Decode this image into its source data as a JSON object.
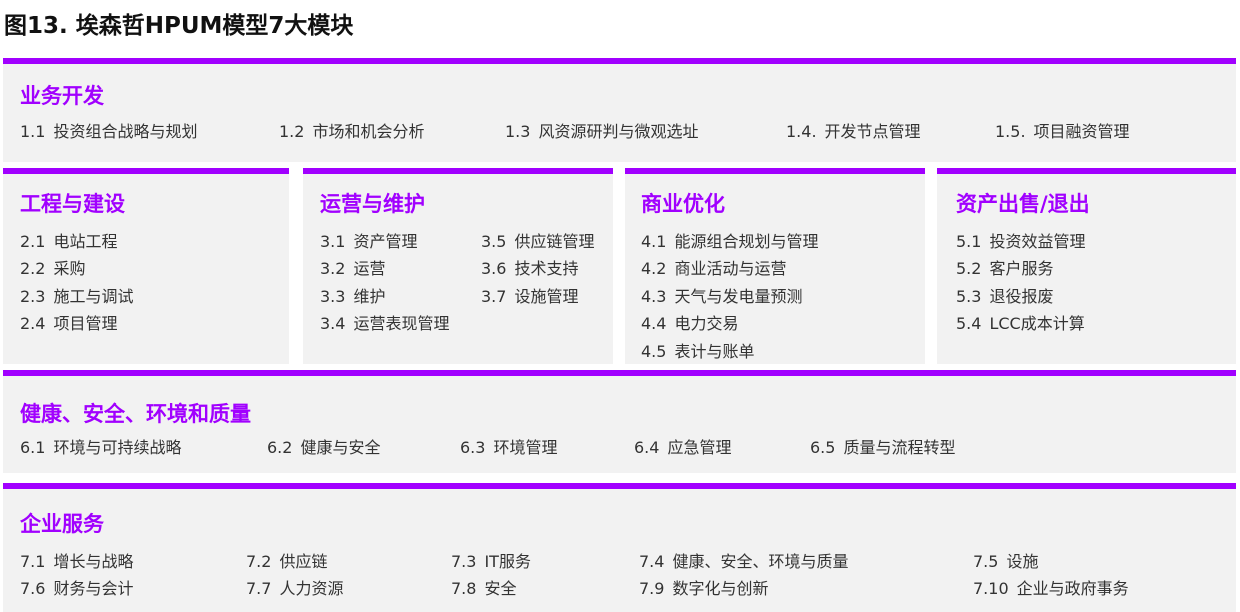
{
  "title": "图13. 埃森哲HPUM模型7大模块",
  "accent_color": "#a100ff",
  "panel_bg": "#f2f2f2",
  "modules": [
    {
      "heading": "业务开发",
      "items": [
        {
          "num": "1.1",
          "text": "投资组合战略与规划"
        },
        {
          "num": "1.2",
          "text": "市场和机会分析"
        },
        {
          "num": "1.3",
          "text": "风资源研判与微观选址"
        },
        {
          "num": "1.4.",
          "text": "开发节点管理"
        },
        {
          "num": "1.5.",
          "text": "项目融资管理"
        }
      ]
    },
    {
      "heading": "工程与建设",
      "items": [
        {
          "num": "2.1",
          "text": "电站工程"
        },
        {
          "num": "2.2",
          "text": "采购"
        },
        {
          "num": "2.3",
          "text": "施工与调试"
        },
        {
          "num": "2.4",
          "text": "项目管理"
        }
      ]
    },
    {
      "heading": "运营与维护",
      "items": [
        {
          "num": "3.1",
          "text": "资产管理"
        },
        {
          "num": "3.2",
          "text": "运营"
        },
        {
          "num": "3.3",
          "text": "维护"
        },
        {
          "num": "3.4",
          "text": "运营表现管理"
        },
        {
          "num": "3.5",
          "text": "供应链管理"
        },
        {
          "num": "3.6",
          "text": "技术支持"
        },
        {
          "num": "3.7",
          "text": "设施管理"
        }
      ]
    },
    {
      "heading": "商业优化",
      "items": [
        {
          "num": "4.1",
          "text": "能源组合规划与管理"
        },
        {
          "num": "4.2",
          "text": "商业活动与运营"
        },
        {
          "num": "4.3",
          "text": "天气与发电量预测"
        },
        {
          "num": "4.4",
          "text": "电力交易"
        },
        {
          "num": "4.5",
          "text": "表计与账单"
        }
      ]
    },
    {
      "heading": "资产出售/退出",
      "items": [
        {
          "num": "5.1",
          "text": "投资效益管理"
        },
        {
          "num": "5.2",
          "text": "客户服务"
        },
        {
          "num": "5.3",
          "text": "退役报废"
        },
        {
          "num": "5.4",
          "text": "LCC成本计算"
        }
      ]
    },
    {
      "heading": "健康、安全、环境和质量",
      "items": [
        {
          "num": "6.1",
          "text": "环境与可持续战略"
        },
        {
          "num": "6.2",
          "text": "健康与安全"
        },
        {
          "num": "6.3",
          "text": "环境管理"
        },
        {
          "num": "6.4",
          "text": "应急管理"
        },
        {
          "num": "6.5",
          "text": "质量与流程转型"
        }
      ]
    },
    {
      "heading": "企业服务",
      "items": [
        {
          "num": "7.1",
          "text": "增长与战略"
        },
        {
          "num": "7.2",
          "text": "供应链"
        },
        {
          "num": "7.3",
          "text": "IT服务"
        },
        {
          "num": "7.4",
          "text": "健康、安全、环境与质量"
        },
        {
          "num": "7.5",
          "text": "设施"
        },
        {
          "num": "7.6",
          "text": "财务与会计"
        },
        {
          "num": "7.7",
          "text": "人力资源"
        },
        {
          "num": "7.8",
          "text": "安全"
        },
        {
          "num": "7.9",
          "text": "数字化与创新"
        },
        {
          "num": "7.10",
          "text": "企业与政府事务"
        }
      ]
    }
  ]
}
